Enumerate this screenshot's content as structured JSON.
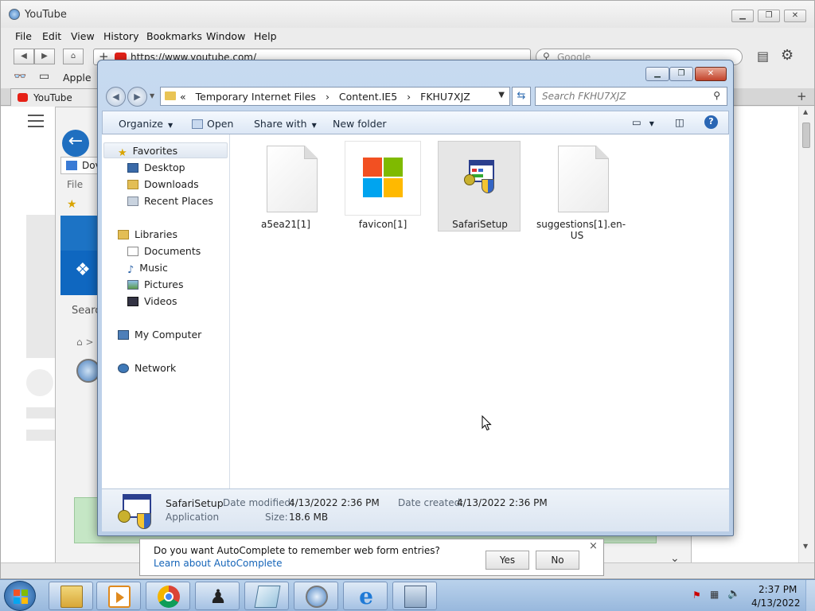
{
  "safari": {
    "title": "YouTube",
    "menu": [
      "File",
      "Edit",
      "View",
      "History",
      "Bookmarks",
      "Window",
      "Help"
    ],
    "url": "https://www.youtube.com/",
    "search_placeholder": "Google",
    "bookmark_apple": "Apple",
    "tab_title": "YouTube"
  },
  "background_page": {
    "tab_label": "Dov",
    "menu_file": "File",
    "search_text": "Searc",
    "breadcrumb": ">"
  },
  "explorer": {
    "breadcrumbs": [
      "«",
      "Temporary Internet Files",
      "›",
      "Content.IE5",
      "›",
      "FKHU7XJZ"
    ],
    "search_placeholder": "Search FKHU7XJZ",
    "commands": {
      "organize": "Organize",
      "open": "Open",
      "share_with": "Share with",
      "new_folder": "New folder"
    },
    "nav": {
      "favorites": "Favorites",
      "desktop": "Desktop",
      "downloads": "Downloads",
      "recent_places": "Recent Places",
      "libraries": "Libraries",
      "documents": "Documents",
      "music": "Music",
      "pictures": "Pictures",
      "videos": "Videos",
      "my_computer": "My Computer",
      "network": "Network"
    },
    "files": [
      {
        "name": "a5ea21[1]",
        "icon": "blank-document-icon"
      },
      {
        "name": "favicon[1]",
        "icon": "microsoft-logo-icon"
      },
      {
        "name": "SafariSetup",
        "icon": "installer-icon"
      },
      {
        "name": "suggestions[1].en-US",
        "icon": "blank-document-icon"
      }
    ],
    "details": {
      "name": "SafariSetup",
      "type": "Application",
      "modified_label": "Date modified:",
      "modified_value": "4/13/2022 2:36 PM",
      "created_label": "Date created:",
      "created_value": "4/13/2022 2:36 PM",
      "size_label": "Size:",
      "size_value": "18.6 MB"
    }
  },
  "autocomplete": {
    "question": "Do you want AutoComplete to remember web form entries?",
    "link": "Learn about AutoComplete",
    "yes": "Yes",
    "no": "No",
    "close": "×"
  },
  "taskbar": {
    "time": "2:37 PM",
    "date": "4/13/2022"
  },
  "colors": {
    "youtube_red": "#e62117",
    "ms_red": "#f25022",
    "ms_green": "#7fba00",
    "ms_blue": "#00a4ef",
    "ms_yellow": "#ffb900",
    "link_blue": "#1464b8"
  }
}
